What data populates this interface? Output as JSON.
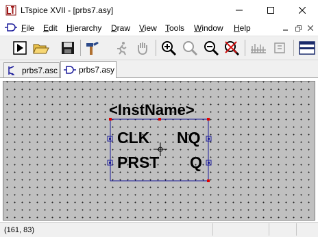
{
  "window": {
    "title": "LTspice XVII - [prbs7.asy]"
  },
  "menu": {
    "items": [
      {
        "label": "File",
        "key": "F",
        "rest": "ile"
      },
      {
        "label": "Edit",
        "key": "E",
        "rest": "dit"
      },
      {
        "label": "Hierarchy",
        "key": "H",
        "rest": "ierarchy"
      },
      {
        "label": "Draw",
        "key": "D",
        "rest": "raw"
      },
      {
        "label": "View",
        "key": "V",
        "rest": "iew"
      },
      {
        "label": "Tools",
        "key": "T",
        "rest": "ools"
      },
      {
        "label": "Window",
        "key": "W",
        "rest": "indow"
      },
      {
        "label": "Help",
        "key": "H",
        "rest": "elp"
      }
    ]
  },
  "toolbar": {
    "icons": [
      "run-icon",
      "open-icon",
      "save-icon",
      "hammer-icon",
      "run-man-icon",
      "pan-hand-icon",
      "zoom-in-icon",
      "zoom-fit-icon",
      "zoom-out-icon",
      "zoom-cancel-icon",
      "control-panel-icon",
      "spice-directive-icon",
      "tile-windows-icon"
    ]
  },
  "tabs": [
    {
      "label": "prbs7.asc",
      "active": false
    },
    {
      "label": "prbs7.asy",
      "active": true
    }
  ],
  "symbol": {
    "inst_name": "<InstName>",
    "pins": {
      "clk": "CLK",
      "nq": "NQ",
      "prst": "PRST",
      "q": "Q"
    }
  },
  "status": {
    "coords": "(161, 83)"
  },
  "colors": {
    "canvas_bg": "#c0c0c0",
    "symbol_line": "#1a1a9a",
    "handle": "#e00000",
    "pin_box": "#1a1a9a"
  }
}
